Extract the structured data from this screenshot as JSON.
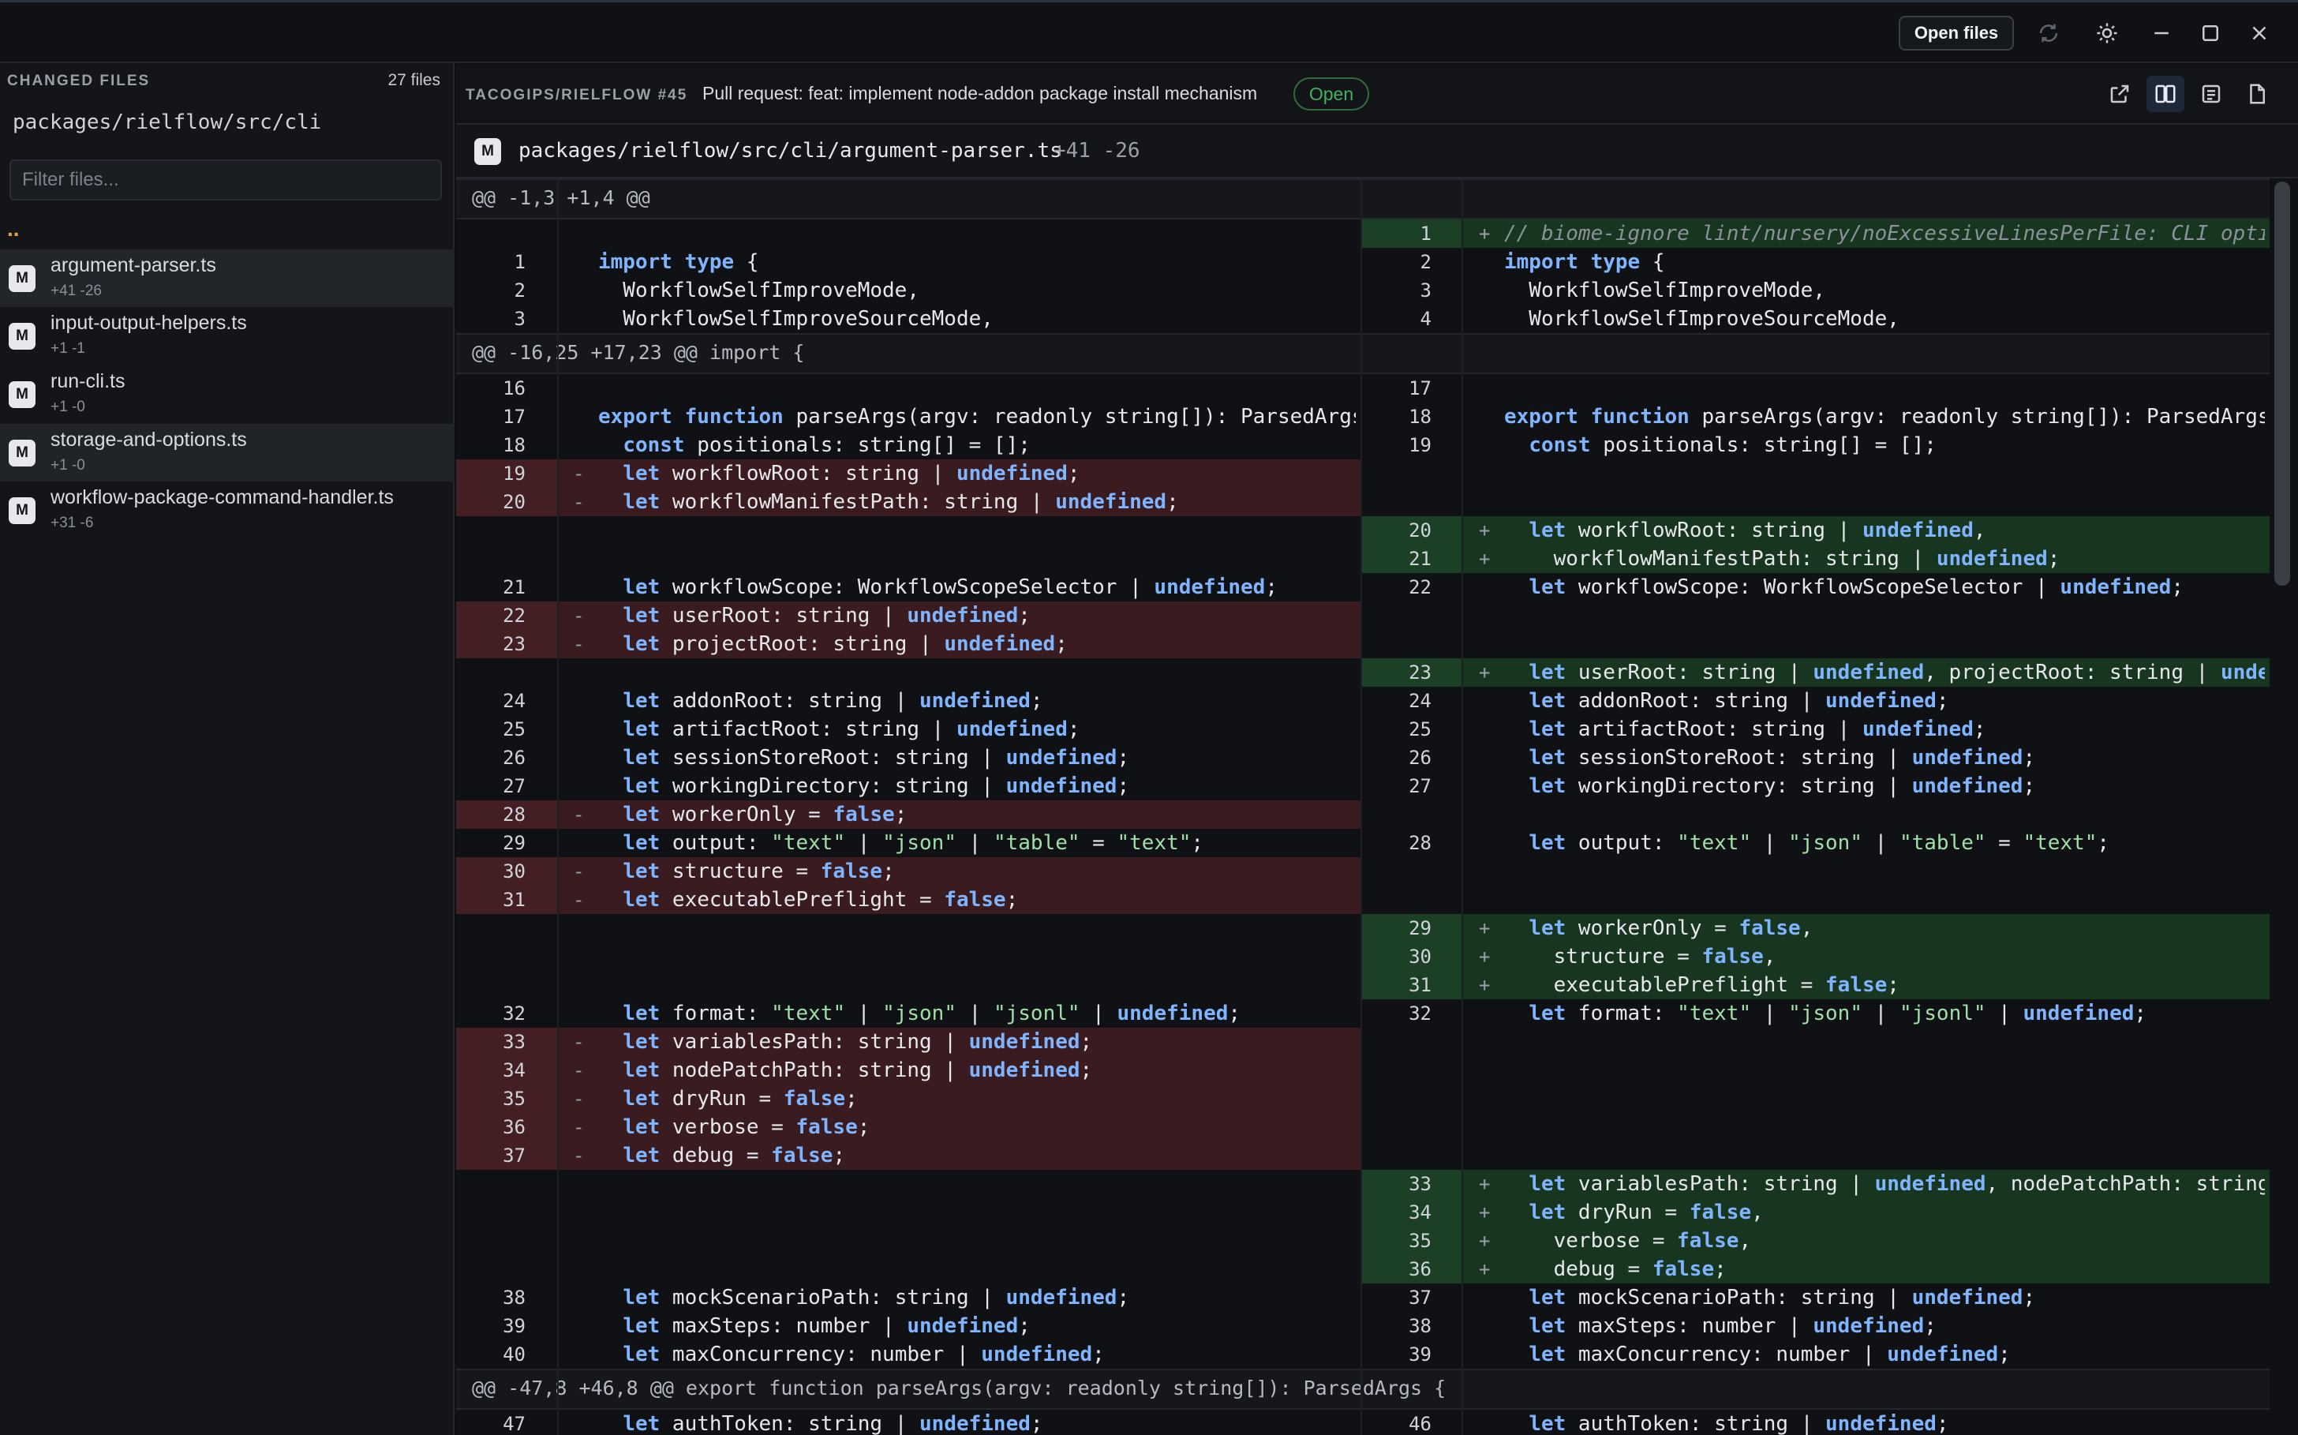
{
  "toolbar": {
    "open_files_label": "Open files",
    "icons": [
      "refresh-icon",
      "theme-toggle-icon",
      "minimize-icon",
      "maximize-icon",
      "close-icon"
    ]
  },
  "sidebar": {
    "title": "CHANGED FILES",
    "count": "27 files",
    "path": "packages/rielflow/src/cli",
    "filter_placeholder": "Filter files...",
    "parent_dir": "..",
    "files": [
      {
        "badge": "M",
        "name": "argument-parser.ts",
        "stat": "+41 -26"
      },
      {
        "badge": "M",
        "name": "input-output-helpers.ts",
        "stat": "+1 -1"
      },
      {
        "badge": "M",
        "name": "run-cli.ts",
        "stat": "+1 -0"
      },
      {
        "badge": "M",
        "name": "storage-and-options.ts",
        "stat": "+1 -0"
      },
      {
        "badge": "M",
        "name": "workflow-package-command-handler.ts",
        "stat": "+31 -6"
      }
    ]
  },
  "pr": {
    "repo": "TACOGIPS/RIELFLOW #45",
    "title": "Pull request: feat: implement node-addon package install mechanism",
    "status": "Open",
    "status_color": "#3fb160",
    "icons": [
      "external-link-icon",
      "split-view-icon",
      "unified-view-icon",
      "file-view-icon"
    ]
  },
  "file_header": {
    "badge": "M",
    "path": "packages/rielflow/src/cli/argument-parser.ts",
    "stat": "+41 -26"
  },
  "diff": {
    "colors": {
      "deleted": "#3a1b20",
      "added": "#17351f",
      "keyword": "#7fb4ff",
      "string": "#9ee0a8"
    },
    "hunks": [
      {
        "header": "@@ -1,3 +1,4 @@"
      },
      {
        "header": "@@ -16,25 +17,23 @@ import {"
      },
      {
        "header": "@@ -47,8 +46,8 @@ export function parseArgs(argv: readonly string[]): ParsedArgs {"
      }
    ],
    "rows": [
      {
        "l": null,
        "r": {
          "n": "1",
          "t": "+",
          "code": "// biome-ignore lint/nursery/noExcessiveLinesPerFile: CLI option"
        }
      },
      {
        "l": {
          "n": "1",
          "t": " ",
          "code": "import type {"
        },
        "r": {
          "n": "2",
          "t": " ",
          "code": "import type {"
        }
      },
      {
        "l": {
          "n": "2",
          "t": " ",
          "code": "  WorkflowSelfImproveMode,"
        },
        "r": {
          "n": "3",
          "t": " ",
          "code": "  WorkflowSelfImproveMode,"
        }
      },
      {
        "l": {
          "n": "3",
          "t": " ",
          "code": "  WorkflowSelfImproveSourceMode,"
        },
        "r": {
          "n": "4",
          "t": " ",
          "code": "  WorkflowSelfImproveSourceMode,"
        }
      },
      {
        "hunk": 1
      },
      {
        "l": {
          "n": "16",
          "t": " ",
          "code": ""
        },
        "r": {
          "n": "17",
          "t": " ",
          "code": ""
        }
      },
      {
        "l": {
          "n": "17",
          "t": " ",
          "code": "export function parseArgs(argv: readonly string[]): ParsedArgs {"
        },
        "r": {
          "n": "18",
          "t": " ",
          "code": "export function parseArgs(argv: readonly string[]): ParsedArgs {"
        }
      },
      {
        "l": {
          "n": "18",
          "t": " ",
          "code": "  const positionals: string[] = [];"
        },
        "r": {
          "n": "19",
          "t": " ",
          "code": "  const positionals: string[] = [];"
        }
      },
      {
        "l": {
          "n": "19",
          "t": "-",
          "code": "  let workflowRoot: string | undefined;"
        },
        "r": null
      },
      {
        "l": {
          "n": "20",
          "t": "-",
          "code": "  let workflowManifestPath: string | undefined;"
        },
        "r": null
      },
      {
        "l": null,
        "r": {
          "n": "20",
          "t": "+",
          "code": "  let workflowRoot: string | undefined,"
        }
      },
      {
        "l": null,
        "r": {
          "n": "21",
          "t": "+",
          "code": "    workflowManifestPath: string | undefined;"
        }
      },
      {
        "l": {
          "n": "21",
          "t": " ",
          "code": "  let workflowScope: WorkflowScopeSelector | undefined;"
        },
        "r": {
          "n": "22",
          "t": " ",
          "code": "  let workflowScope: WorkflowScopeSelector | undefined;"
        }
      },
      {
        "l": {
          "n": "22",
          "t": "-",
          "code": "  let userRoot: string | undefined;"
        },
        "r": null
      },
      {
        "l": {
          "n": "23",
          "t": "-",
          "code": "  let projectRoot: string | undefined;"
        },
        "r": null
      },
      {
        "l": null,
        "r": {
          "n": "23",
          "t": "+",
          "code": "  let userRoot: string | undefined, projectRoot: string | undefined;"
        }
      },
      {
        "l": {
          "n": "24",
          "t": " ",
          "code": "  let addonRoot: string | undefined;"
        },
        "r": {
          "n": "24",
          "t": " ",
          "code": "  let addonRoot: string | undefined;"
        }
      },
      {
        "l": {
          "n": "25",
          "t": " ",
          "code": "  let artifactRoot: string | undefined;"
        },
        "r": {
          "n": "25",
          "t": " ",
          "code": "  let artifactRoot: string | undefined;"
        }
      },
      {
        "l": {
          "n": "26",
          "t": " ",
          "code": "  let sessionStoreRoot: string | undefined;"
        },
        "r": {
          "n": "26",
          "t": " ",
          "code": "  let sessionStoreRoot: string | undefined;"
        }
      },
      {
        "l": {
          "n": "27",
          "t": " ",
          "code": "  let workingDirectory: string | undefined;"
        },
        "r": {
          "n": "27",
          "t": " ",
          "code": "  let workingDirectory: string | undefined;"
        }
      },
      {
        "l": {
          "n": "28",
          "t": "-",
          "code": "  let workerOnly = false;"
        },
        "r": null
      },
      {
        "l": {
          "n": "29",
          "t": " ",
          "code": "  let output: \"text\" | \"json\" | \"table\" = \"text\";"
        },
        "r": {
          "n": "28",
          "t": " ",
          "code": "  let output: \"text\" | \"json\" | \"table\" = \"text\";"
        }
      },
      {
        "l": {
          "n": "30",
          "t": "-",
          "code": "  let structure = false;"
        },
        "r": null
      },
      {
        "l": {
          "n": "31",
          "t": "-",
          "code": "  let executablePreflight = false;"
        },
        "r": null
      },
      {
        "l": null,
        "r": {
          "n": "29",
          "t": "+",
          "code": "  let workerOnly = false,"
        }
      },
      {
        "l": null,
        "r": {
          "n": "30",
          "t": "+",
          "code": "    structure = false,"
        }
      },
      {
        "l": null,
        "r": {
          "n": "31",
          "t": "+",
          "code": "    executablePreflight = false;"
        }
      },
      {
        "l": {
          "n": "32",
          "t": " ",
          "code": "  let format: \"text\" | \"json\" | \"jsonl\" | undefined;"
        },
        "r": {
          "n": "32",
          "t": " ",
          "code": "  let format: \"text\" | \"json\" | \"jsonl\" | undefined;"
        }
      },
      {
        "l": {
          "n": "33",
          "t": "-",
          "code": "  let variablesPath: string | undefined;"
        },
        "r": null
      },
      {
        "l": {
          "n": "34",
          "t": "-",
          "code": "  let nodePatchPath: string | undefined;"
        },
        "r": null
      },
      {
        "l": {
          "n": "35",
          "t": "-",
          "code": "  let dryRun = false;"
        },
        "r": null
      },
      {
        "l": {
          "n": "36",
          "t": "-",
          "code": "  let verbose = false;"
        },
        "r": null
      },
      {
        "l": {
          "n": "37",
          "t": "-",
          "code": "  let debug = false;"
        },
        "r": null
      },
      {
        "l": null,
        "r": {
          "n": "33",
          "t": "+",
          "code": "  let variablesPath: string | undefined, nodePatchPath: string | undefined;"
        }
      },
      {
        "l": null,
        "r": {
          "n": "34",
          "t": "+",
          "code": "  let dryRun = false,"
        }
      },
      {
        "l": null,
        "r": {
          "n": "35",
          "t": "+",
          "code": "    verbose = false,"
        }
      },
      {
        "l": null,
        "r": {
          "n": "36",
          "t": "+",
          "code": "    debug = false;"
        }
      },
      {
        "l": {
          "n": "38",
          "t": " ",
          "code": "  let mockScenarioPath: string | undefined;"
        },
        "r": {
          "n": "37",
          "t": " ",
          "code": "  let mockScenarioPath: string | undefined;"
        }
      },
      {
        "l": {
          "n": "39",
          "t": " ",
          "code": "  let maxSteps: number | undefined;"
        },
        "r": {
          "n": "38",
          "t": " ",
          "code": "  let maxSteps: number | undefined;"
        }
      },
      {
        "l": {
          "n": "40",
          "t": " ",
          "code": "  let maxConcurrency: number | undefined;"
        },
        "r": {
          "n": "39",
          "t": " ",
          "code": "  let maxConcurrency: number | undefined;"
        }
      },
      {
        "hunk": 2
      },
      {
        "l": {
          "n": "47",
          "t": " ",
          "code": "  let authToken: string | undefined;"
        },
        "r": {
          "n": "46",
          "t": " ",
          "code": "  let authToken: string | undefined;"
        }
      }
    ]
  }
}
